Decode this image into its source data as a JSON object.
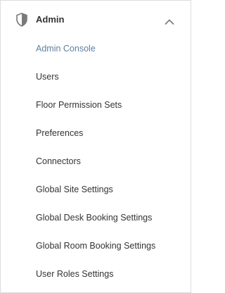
{
  "section": {
    "title": "Admin",
    "icon": "shield-icon",
    "toggle_icon": "chevron-up-icon",
    "expanded": true
  },
  "menu": {
    "items": [
      {
        "label": "Admin Console",
        "active": true
      },
      {
        "label": "Users",
        "active": false
      },
      {
        "label": "Floor Permission Sets",
        "active": false
      },
      {
        "label": "Preferences",
        "active": false
      },
      {
        "label": "Connectors",
        "active": false
      },
      {
        "label": "Global Site Settings",
        "active": false
      },
      {
        "label": "Global Desk Booking Settings",
        "active": false
      },
      {
        "label": "Global Room Booking Settings",
        "active": false
      },
      {
        "label": "User Roles Settings",
        "active": false
      }
    ]
  },
  "colors": {
    "text": "#333333",
    "active": "#5f7f9e",
    "icon": "#7a7a7a",
    "border": "#dcdcdc"
  }
}
